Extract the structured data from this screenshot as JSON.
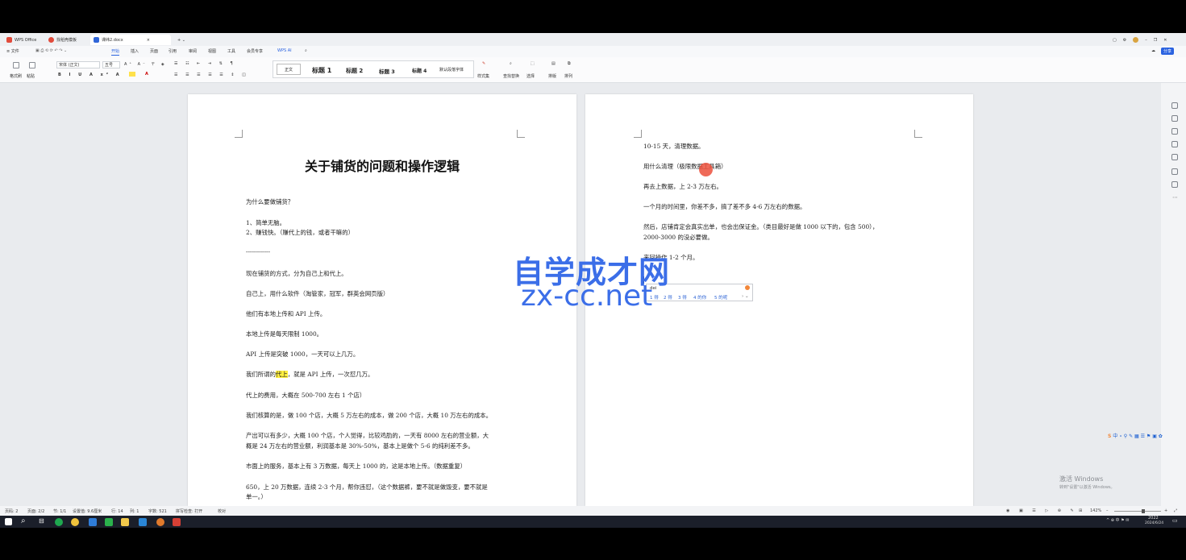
{
  "tabs": [
    {
      "label": "WPS Office",
      "color": "#e14b3b"
    },
    {
      "label": "找稻壳模板",
      "color": "#e14b3b"
    },
    {
      "label": "课纬2.docx",
      "color": "#3166d8"
    }
  ],
  "menu": [
    "≡ 文件",
    "开始",
    "插入",
    "页面",
    "引用",
    "审阅",
    "视图",
    "工具",
    "会员专享",
    "WPS AI"
  ],
  "ribbon": {
    "font_name": "宋体 (正文)",
    "font_size": "五号",
    "format_painter": "格式刷",
    "paste": "粘贴",
    "styles": [
      "正文",
      "标题 1",
      "标题 2",
      "标题 3",
      "标题 4",
      "默认段落字体"
    ],
    "style_set": "样式集",
    "find_replace": "查找替换",
    "select": "选择",
    "sort": "排版",
    "arrange": "排列",
    "share": "分享"
  },
  "left_page": {
    "title": "关于铺货的问题和操作逻辑",
    "lines": [
      "为什么要做铺货？",
      "1、简单无脑。",
      "2、赚钱快。（赚代上的钱，或者干嘛的）",
      "------------",
      "现在铺货的方式，分为自己上和代上。",
      "自己上，用什么软件（淘管家，冠军，群英会网页版）",
      "他们有本地上传和 API 上传。",
      "本地上传是每天限制 1000。",
      "API 上传是突破 1000，一天可以上几万。",
      "代上的费用，大概在 500-700 左右 1 个店）",
      "我们核算的是，做 100 个店，大概 5 万左右的成本，做 200 个店，大概 10 万左右的成本。",
      "产出可以有多少，大概 100 个店，个人觉得，比较鸡肋的，一天有 8000 左右的营业额，大",
      "概是 24 万左右的营业额，利润基本是 30%-50%，基本上是做个 5-6 的纯利差不多。",
      "市面上的服务，基本上有 3 万数据，每天上 1000 的，这是本地上传。（数据重复）",
      "650，上 20 万数据，连续 2-3 个月，帮你违怼，（这个数据裤，要不就是做毁变，要不就是",
      "单一。）"
    ],
    "line_special": {
      "before": "我们所谓的",
      "highlight": "代上",
      "after": "，就是 API 上传，一次怼几万。"
    }
  },
  "right_page": {
    "lines": [
      "10-15 天，清理数据。",
      "用什么清理（极限数据工具箱）",
      "再去上数据，上 2-3 万左右。",
      "一个月的时间里，你差不多，搞了差不多 4-6 万左右的数据。",
      "然后，店铺肯定会真实出单，也会出保证金。（类目最好是做 1000 以下的，包含 500），",
      "2000-3000 的没必要做。",
      "来回操作 1-2 个月。"
    ]
  },
  "ime": {
    "composition": "dei",
    "candidates": [
      "1 得",
      "2 得",
      "3 得",
      "4 的你",
      "5 的呢"
    ]
  },
  "watermark": {
    "line1": "自学成才网",
    "line2": "zx-cc.net"
  },
  "status": [
    "页码: 2",
    "页面: 2/2",
    "节: 1/1",
    "设置值: 9.6厘米",
    "行: 14",
    "列: 1",
    "字数: 521",
    "拼写检查: 打开",
    "校对"
  ],
  "zoom": "142%",
  "activate": {
    "title": "激活 Windows",
    "hint": "转到\"设置\"以激活 Windows。"
  },
  "clock": {
    "time": "2022",
    "date": "2024/6/24"
  }
}
